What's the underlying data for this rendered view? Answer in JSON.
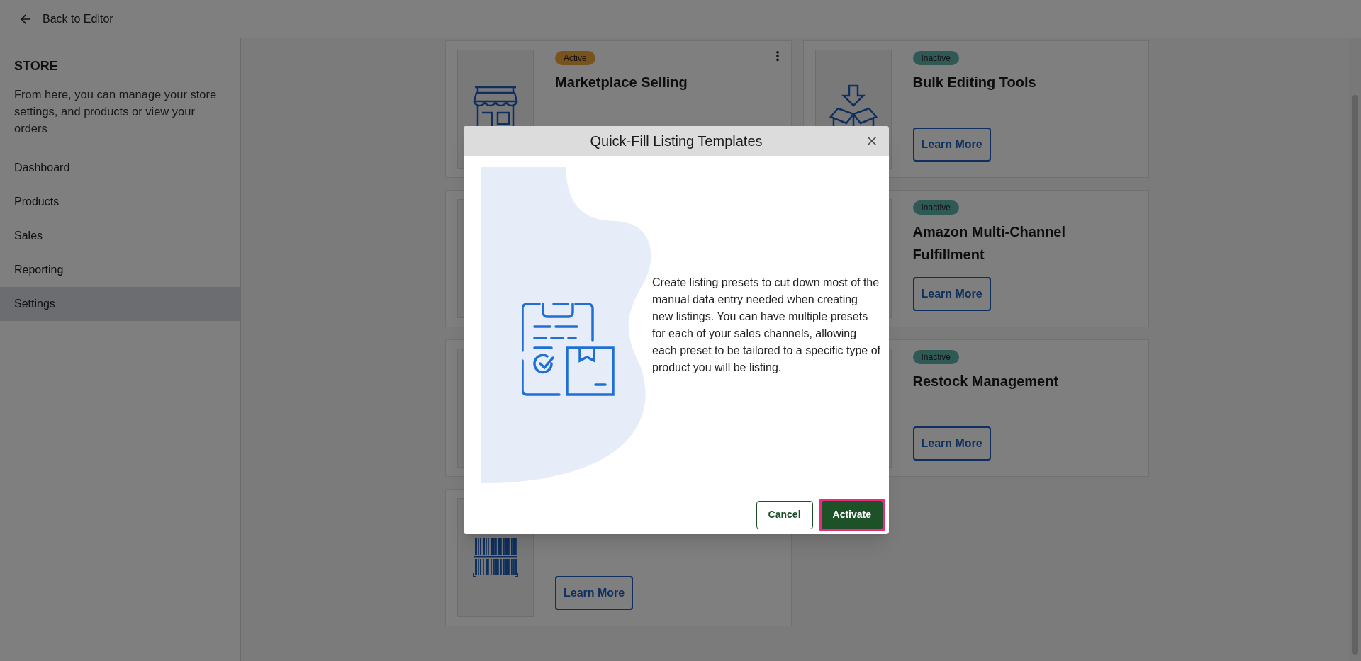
{
  "header": {
    "back_link": "Back to Editor"
  },
  "sidebar": {
    "title": "STORE",
    "description": "From here, you can manage your store settings, and products or view your orders",
    "items": [
      {
        "label": "Dashboard",
        "selected": false
      },
      {
        "label": "Products",
        "selected": false
      },
      {
        "label": "Sales",
        "selected": false
      },
      {
        "label": "Reporting",
        "selected": false
      },
      {
        "label": "Settings",
        "selected": true
      }
    ]
  },
  "cards": [
    {
      "kind": "store",
      "status": {
        "label": "Active",
        "kind": "active"
      },
      "title": "Marketplace Selling",
      "menu": true
    },
    {
      "kind": "box",
      "status": {
        "label": "Inactive",
        "kind": "inactive"
      },
      "title": "Bulk Editing Tools",
      "action": "Learn More"
    },
    {
      "kind": "blank"
    },
    {
      "kind": "blank",
      "status": {
        "label": "Inactive",
        "kind": "inactive"
      },
      "title": "Amazon Multi-Channel Fulfillment",
      "action": "Learn More"
    },
    {
      "kind": "blank"
    },
    {
      "kind": "blank",
      "status": {
        "label": "Inactive",
        "kind": "inactive"
      },
      "title": "Restock Management",
      "action": "Learn More"
    },
    {
      "kind": "barcode",
      "action": "Learn More"
    }
  ],
  "modal": {
    "title": "Quick-Fill Listing Templates",
    "body": "Create listing presets to cut down most of the manual data entry needed when creating new listings. You can have multiple presets for each of your sales channels, allowing each preset to be tailored to a specific type of product you will be listing.",
    "buttons": [
      {
        "label": "Cancel",
        "kind": "secondary",
        "highlighted": false
      },
      {
        "label": "Activate",
        "kind": "primary",
        "highlighted": true
      }
    ]
  }
}
